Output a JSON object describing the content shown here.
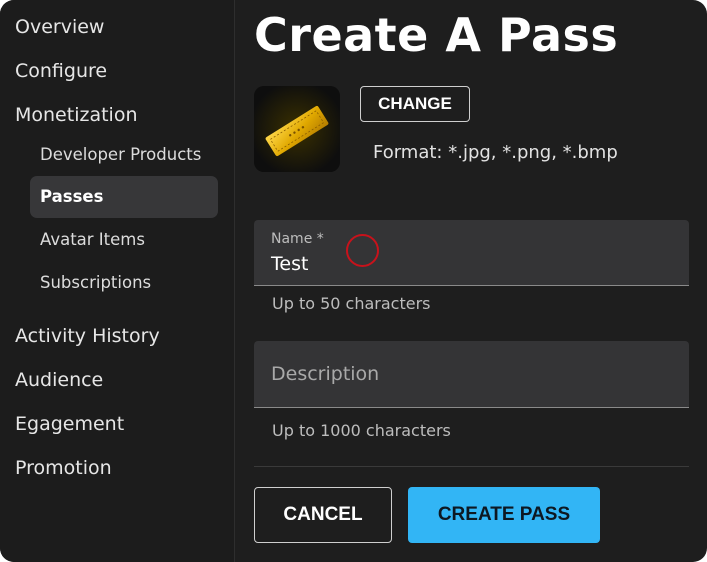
{
  "sidebar": {
    "items": [
      {
        "label": "Overview"
      },
      {
        "label": "Configure"
      },
      {
        "label": "Monetization"
      },
      {
        "label": "Activity History"
      },
      {
        "label": "Audience"
      },
      {
        "label": "Egagement"
      },
      {
        "label": "Promotion"
      }
    ],
    "monetization_sub": [
      {
        "label": "Developer Products"
      },
      {
        "label": "Passes",
        "active": true
      },
      {
        "label": "Avatar Items"
      },
      {
        "label": "Subscriptions"
      }
    ]
  },
  "main": {
    "title": "Create A Pass",
    "image": {
      "thumbnail_icon": "golden-ticket-icon",
      "change_label": "CHANGE",
      "format_text": "Format: *.jpg, *.png, *.bmp"
    },
    "name_field": {
      "label": "Name *",
      "value": "Test",
      "helper": "Up to 50 characters"
    },
    "description_field": {
      "placeholder": "Description",
      "helper": "Up to 1000 characters"
    },
    "buttons": {
      "cancel": "CANCEL",
      "create": "CREATE PASS"
    }
  },
  "colors": {
    "background": "#1e1e1e",
    "sidebar_active": "#373739",
    "field_background": "#343436",
    "accent": "#32b5f5",
    "click_marker": "#c8121b"
  }
}
